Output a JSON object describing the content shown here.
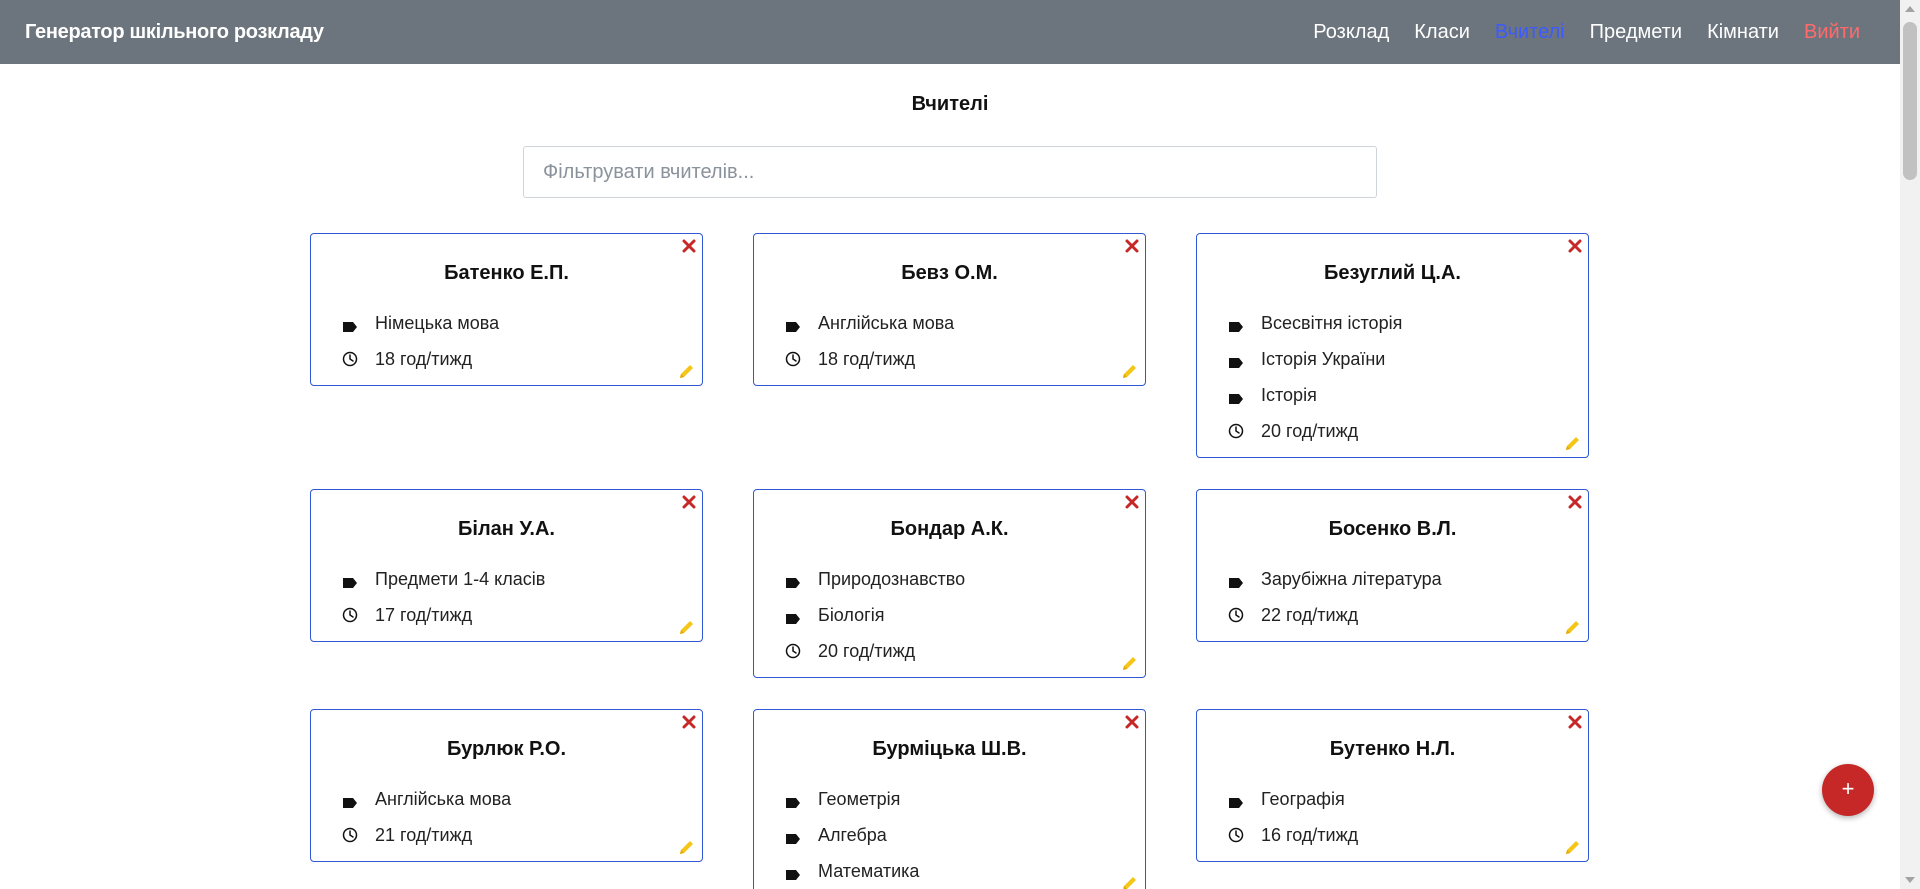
{
  "app": {
    "brand": "Генератор шкільного розкладу"
  },
  "nav": {
    "schedule": "Розклад",
    "classes": "Класи",
    "teachers": "Вчителі",
    "subjects": "Предмети",
    "rooms": "Кімнати",
    "logout": "Вийти"
  },
  "page": {
    "title": "Вчителі"
  },
  "filter": {
    "placeholder": "Фільтрувати вчителів...",
    "value": ""
  },
  "teachers": [
    {
      "name": "Батенко Е.П.",
      "subjects": [
        "Німецька мова"
      ],
      "hours": "18 год/тижд"
    },
    {
      "name": "Бевз О.М.",
      "subjects": [
        "Англійська мова"
      ],
      "hours": "18 год/тижд"
    },
    {
      "name": "Безуглий Ц.А.",
      "subjects": [
        "Всесвітня історія",
        "Історія України",
        "Історія"
      ],
      "hours": "20 год/тижд"
    },
    {
      "name": "Білан У.А.",
      "subjects": [
        "Предмети 1-4 класів"
      ],
      "hours": "17 год/тижд"
    },
    {
      "name": "Бондар А.К.",
      "subjects": [
        "Природознавство",
        "Біологія"
      ],
      "hours": "20 год/тижд"
    },
    {
      "name": "Босенко В.Л.",
      "subjects": [
        "Зарубіжна література"
      ],
      "hours": "22 год/тижд"
    },
    {
      "name": "Бурлюк Р.О.",
      "subjects": [
        "Англійська мова"
      ],
      "hours": "21 год/тижд"
    },
    {
      "name": "Бурміцька Ш.В.",
      "subjects": [
        "Геометрія",
        "Алгебра",
        "Математика"
      ],
      "hours": ""
    },
    {
      "name": "Бутенко Н.Л.",
      "subjects": [
        "Географія"
      ],
      "hours": "16 год/тижд"
    }
  ],
  "fab": {
    "label": "+"
  },
  "colors": {
    "navbar": "#6c757d",
    "active_link": "#3d5afe",
    "logout": "#ff6b6b",
    "card_border": "#2f57d6",
    "delete": "#c62828",
    "edit": "#f5c518",
    "fab": "#c62828"
  },
  "icons": {
    "subject": "tag-icon",
    "hours": "clock-icon",
    "delete": "close-icon",
    "edit": "pencil-icon"
  }
}
